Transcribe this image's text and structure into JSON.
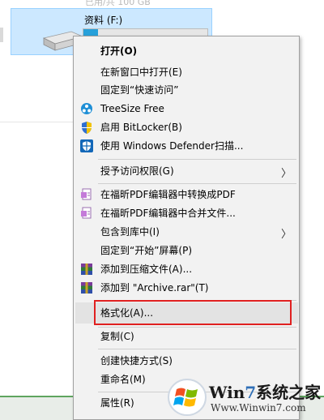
{
  "explorer": {
    "top_partial_text": "已用/共 100 GB",
    "drive_name": "资料 (F:)",
    "drive_usage_fraction": 0.12,
    "colors": {
      "selection_bg": "#cce8ff",
      "bar_fill": "#26a0da"
    }
  },
  "menu": {
    "items": [
      {
        "label": "打开(O)",
        "bold": true,
        "icon": ""
      },
      {
        "label": "在新窗口中打开(E)",
        "icon": ""
      },
      {
        "label": "固定到“快速访问”",
        "icon": ""
      },
      {
        "label": "TreeSize Free",
        "icon": "treesize-icon"
      },
      {
        "label": "启用 BitLocker(B)",
        "icon": "bitlocker-shield-icon"
      },
      {
        "label": "使用 Windows Defender扫描...",
        "icon": "defender-shield-icon"
      },
      {
        "label": "授予访问权限(G)",
        "icon": "",
        "submenu": true
      },
      {
        "label": "在福昕PDF编辑器中转换成PDF",
        "icon": "foxit-pdf-icon"
      },
      {
        "label": "在福昕PDF编辑器中合并文件...",
        "icon": "foxit-pdf-icon"
      },
      {
        "label": "包含到库中(I)",
        "icon": "",
        "submenu": true
      },
      {
        "label": "固定到“开始”屏幕(P)",
        "icon": ""
      },
      {
        "label": "添加到压缩文件(A)...",
        "icon": "winrar-icon"
      },
      {
        "label": "添加到 \"Archive.rar\"(T)",
        "icon": "winrar-icon"
      },
      {
        "label": "格式化(A)...",
        "icon": "",
        "highlighted": true
      },
      {
        "label": "复制(C)",
        "icon": ""
      },
      {
        "label": "创建快捷方式(S)",
        "icon": ""
      },
      {
        "label": "重命名(M)",
        "icon": ""
      },
      {
        "label": "属性(R)",
        "icon": ""
      }
    ],
    "submenu_arrow": "〉"
  },
  "watermark": {
    "brand_w": "W",
    "brand_in": "in",
    "brand_7": "7",
    "brand_cn": "系统之家",
    "url": "Www.Winwin7.com"
  }
}
